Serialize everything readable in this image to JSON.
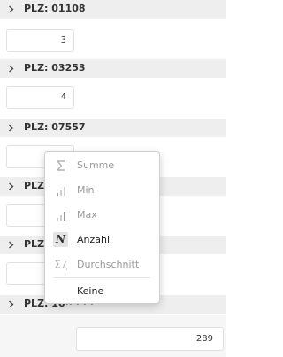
{
  "groups": [
    {
      "label": "PLZ: 01108",
      "value": "3"
    },
    {
      "label": "PLZ: 03253",
      "value": "4"
    },
    {
      "label": "PLZ: 07557",
      "value": ""
    },
    {
      "label": "PLZ:",
      "value": ""
    },
    {
      "label": "PLZ:",
      "value": ""
    },
    {
      "label": "PLZ: 16·· · · ·",
      "value": ""
    }
  ],
  "total": {
    "value": "289"
  },
  "aggregate_menu": {
    "items": [
      {
        "label": "Summe",
        "icon": "sum-icon",
        "state": "disabled"
      },
      {
        "label": "Min",
        "icon": "bar-chart-min-icon",
        "state": "disabled"
      },
      {
        "label": "Max",
        "icon": "bar-chart-max-icon",
        "state": "disabled"
      },
      {
        "label": "Anzahl",
        "icon": "count-n-icon",
        "state": "enabled"
      },
      {
        "label": "Durchschnitt",
        "icon": "average-icon",
        "state": "disabled"
      },
      {
        "label": "Keine",
        "icon": "",
        "state": "enabled"
      }
    ]
  },
  "colors": {
    "header_bg": "#eeeeee",
    "disabled_text": "#999999",
    "menu_border": "#d0d0d0"
  }
}
